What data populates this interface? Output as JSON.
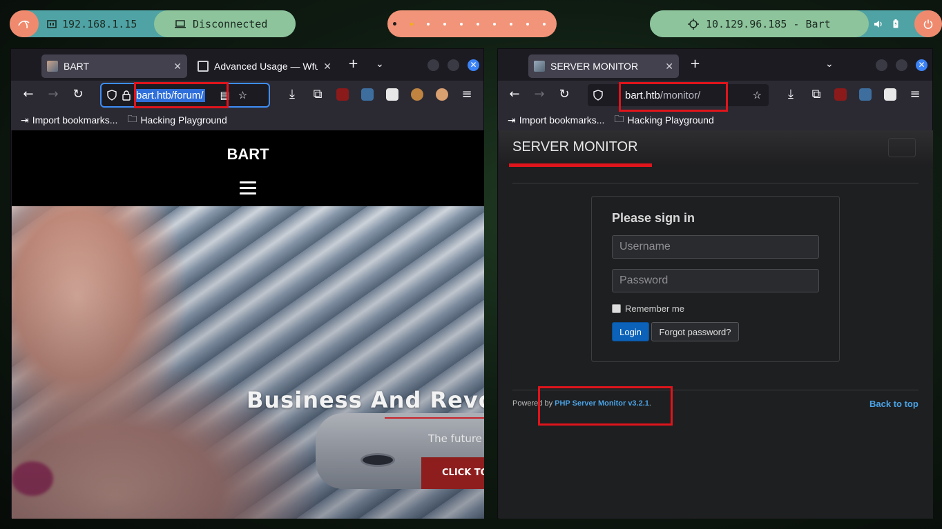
{
  "topbar": {
    "local_ip": "192.168.1.15",
    "vpn_status": "Disconnected",
    "target": "10.129.96.185 - Bart",
    "colors": {
      "teal": "#4fa3a5",
      "green": "#8dc49b",
      "salmon": "#f29479"
    }
  },
  "left_browser": {
    "tabs": [
      {
        "label": "BART"
      },
      {
        "label": "Advanced Usage — Wfuzz"
      }
    ],
    "url": "bart.htb/forum/",
    "bookmarks": [
      "Import bookmarks...",
      "Hacking Playground"
    ],
    "page": {
      "title": "BART",
      "hero_title": "Business And Revolu",
      "hero_subtitle": "The future",
      "cta": "CLICK TO"
    }
  },
  "right_browser": {
    "tabs": [
      {
        "label": "SERVER MONITOR"
      }
    ],
    "url_host": "bart.htb",
    "url_path": "/monitor/",
    "bookmarks": [
      "Import bookmarks...",
      "Hacking Playground"
    ],
    "page": {
      "brand": "SERVER MONITOR",
      "signin_heading": "Please sign in",
      "username_placeholder": "Username",
      "password_placeholder": "Password",
      "remember_label": "Remember me",
      "login_label": "Login",
      "forgot_label": "Forgot password?",
      "footer_prefix": "Powered by ",
      "footer_link": "PHP Server Monitor v3.2.1",
      "footer_suffix": ".",
      "back_to_top": "Back to top"
    }
  }
}
